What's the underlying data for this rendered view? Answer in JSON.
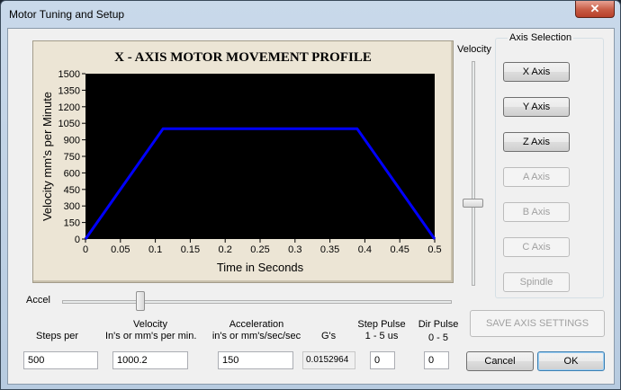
{
  "window": {
    "title": "Motor Tuning and Setup",
    "close_glyph": "✕"
  },
  "chart_data": {
    "type": "line",
    "title": "X - AXIS MOTOR MOVEMENT PROFILE",
    "xlabel": "Time in Seconds",
    "ylabel": "Velocity mm's per Minute",
    "xlim": [
      0,
      0.5
    ],
    "ylim": [
      0,
      1500
    ],
    "x_ticks": [
      "0",
      "0.05",
      "0.1",
      "0.15",
      "0.2",
      "0.25",
      "0.3",
      "0.35",
      "0.4",
      "0.45",
      "0.5"
    ],
    "y_ticks": [
      "0",
      "150",
      "300",
      "450",
      "600",
      "750",
      "900",
      "1050",
      "1200",
      "1350",
      "1500"
    ],
    "grid": false,
    "series": [
      {
        "color": "#0000ff",
        "x": [
          0,
          0.111,
          0.389,
          0.5
        ],
        "y": [
          0,
          1000.2,
          1000.2,
          0
        ]
      }
    ],
    "plot_background": "#000000"
  },
  "velocity_slider": {
    "label": "Velocity",
    "level_fraction": 0.37
  },
  "accel_slider": {
    "label": "Accel",
    "level_fraction": 0.2
  },
  "axis_selection": {
    "label": "Axis Selection",
    "buttons": [
      {
        "label": "X Axis",
        "enabled": true
      },
      {
        "label": "Y Axis",
        "enabled": true
      },
      {
        "label": "Z Axis",
        "enabled": true
      },
      {
        "label": "A Axis",
        "enabled": false
      },
      {
        "label": "B Axis",
        "enabled": false
      },
      {
        "label": "C Axis",
        "enabled": false
      },
      {
        "label": "Spindle",
        "enabled": false
      }
    ]
  },
  "fields": {
    "steps_per": {
      "label": "Steps per",
      "value": "500"
    },
    "velocity": {
      "label_line1": "Velocity",
      "label_line2": "In's or mm's per min.",
      "value": "1000.2"
    },
    "acceleration": {
      "label_line1": "Acceleration",
      "label_line2": "in's or mm's/sec/sec",
      "value": "150"
    },
    "gs": {
      "label": "G's",
      "value": "0.0152964"
    },
    "step_pulse": {
      "label_line1": "Step Pulse",
      "label_line2": "1 - 5 us",
      "value": "0"
    },
    "dir_pulse": {
      "label_line1": "Dir Pulse",
      "label_line2": "0 - 5",
      "value": "0"
    }
  },
  "buttons": {
    "save_axis_settings": "SAVE AXIS SETTINGS",
    "cancel": "Cancel",
    "ok": "OK"
  }
}
